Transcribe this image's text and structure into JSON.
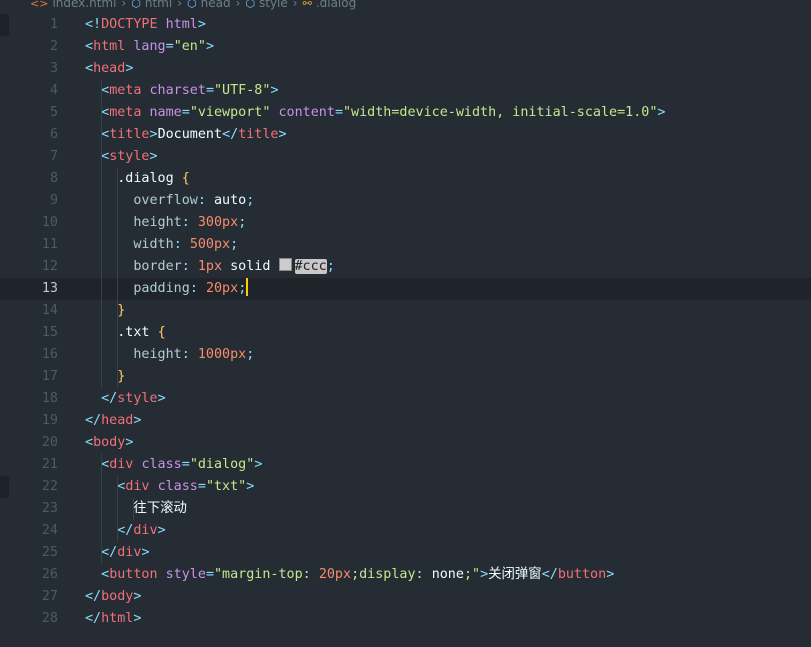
{
  "breadcrumb": [
    {
      "icon": "html-file-icon",
      "label": "index.html",
      "color": "#e37933"
    },
    {
      "icon": "cube-icon",
      "label": "html",
      "color": "#75beff"
    },
    {
      "icon": "cube-icon",
      "label": "head",
      "color": "#75beff"
    },
    {
      "icon": "cube-icon",
      "label": "style",
      "color": "#75beff"
    },
    {
      "icon": "css-selector-icon",
      "label": ".dialog",
      "color": "#e8a33d"
    }
  ],
  "editor": {
    "active_line": 13,
    "cursor_line": 13,
    "lines": [
      [
        [
          "p",
          "<!"
        ],
        [
          "t",
          "DOCTYPE"
        ],
        [
          "x",
          " "
        ],
        [
          "a",
          "html"
        ],
        [
          "p",
          ">"
        ]
      ],
      [
        [
          "p",
          "<"
        ],
        [
          "t",
          "html"
        ],
        [
          "x",
          " "
        ],
        [
          "a",
          "lang"
        ],
        [
          "p",
          "="
        ],
        [
          "s",
          "\"en\""
        ],
        [
          "p",
          ">"
        ]
      ],
      [
        [
          "p",
          "<"
        ],
        [
          "t",
          "head"
        ],
        [
          "p",
          ">"
        ]
      ],
      [
        [
          "x",
          "  "
        ],
        [
          "p",
          "<"
        ],
        [
          "t",
          "meta"
        ],
        [
          "x",
          " "
        ],
        [
          "a",
          "charset"
        ],
        [
          "p",
          "="
        ],
        [
          "s",
          "\"UTF-8\""
        ],
        [
          "p",
          ">"
        ]
      ],
      [
        [
          "x",
          "  "
        ],
        [
          "p",
          "<"
        ],
        [
          "t",
          "meta"
        ],
        [
          "x",
          " "
        ],
        [
          "a",
          "name"
        ],
        [
          "p",
          "="
        ],
        [
          "s",
          "\"viewport\""
        ],
        [
          "x",
          " "
        ],
        [
          "a",
          "content"
        ],
        [
          "p",
          "="
        ],
        [
          "s",
          "\"width=device-width, initial-scale=1.0\""
        ],
        [
          "p",
          ">"
        ]
      ],
      [
        [
          "x",
          "  "
        ],
        [
          "p",
          "<"
        ],
        [
          "t",
          "title"
        ],
        [
          "p",
          ">"
        ],
        [
          "x",
          "Document"
        ],
        [
          "p",
          "</"
        ],
        [
          "t",
          "title"
        ],
        [
          "p",
          ">"
        ]
      ],
      [
        [
          "x",
          "  "
        ],
        [
          "p",
          "<"
        ],
        [
          "t",
          "style"
        ],
        [
          "p",
          ">"
        ]
      ],
      [
        [
          "x",
          "    "
        ],
        [
          "sel",
          ".dialog"
        ],
        [
          "x",
          " "
        ],
        [
          "b",
          "{"
        ]
      ],
      [
        [
          "x",
          "      "
        ],
        [
          "pr",
          "overflow"
        ],
        [
          "p",
          ":"
        ],
        [
          "x",
          " "
        ],
        [
          "k",
          "auto"
        ],
        [
          "p",
          ";"
        ]
      ],
      [
        [
          "x",
          "      "
        ],
        [
          "pr",
          "height"
        ],
        [
          "p",
          ":"
        ],
        [
          "x",
          " "
        ],
        [
          "n",
          "300px"
        ],
        [
          "p",
          ";"
        ]
      ],
      [
        [
          "x",
          "      "
        ],
        [
          "pr",
          "width"
        ],
        [
          "p",
          ":"
        ],
        [
          "x",
          " "
        ],
        [
          "n",
          "500px"
        ],
        [
          "p",
          ";"
        ]
      ],
      [
        [
          "x",
          "      "
        ],
        [
          "pr",
          "border"
        ],
        [
          "p",
          ":"
        ],
        [
          "x",
          " "
        ],
        [
          "n",
          "1px"
        ],
        [
          "x",
          " "
        ],
        [
          "k",
          "solid"
        ],
        [
          "x",
          " "
        ],
        [
          "sw",
          ""
        ],
        [
          "c",
          "#ccc"
        ],
        [
          "p",
          ";"
        ]
      ],
      [
        [
          "x",
          "      "
        ],
        [
          "pr",
          "padding"
        ],
        [
          "p",
          ":"
        ],
        [
          "x",
          " "
        ],
        [
          "n",
          "20px"
        ],
        [
          "p",
          ";"
        ],
        [
          "cur",
          ""
        ]
      ],
      [
        [
          "x",
          "    "
        ],
        [
          "b",
          "}"
        ]
      ],
      [
        [
          "x",
          "    "
        ],
        [
          "sel",
          ".txt"
        ],
        [
          "x",
          " "
        ],
        [
          "b",
          "{"
        ]
      ],
      [
        [
          "x",
          "      "
        ],
        [
          "pr",
          "height"
        ],
        [
          "p",
          ":"
        ],
        [
          "x",
          " "
        ],
        [
          "n",
          "1000px"
        ],
        [
          "p",
          ";"
        ]
      ],
      [
        [
          "x",
          "    "
        ],
        [
          "b",
          "}"
        ]
      ],
      [
        [
          "x",
          "  "
        ],
        [
          "p",
          "</"
        ],
        [
          "t",
          "style"
        ],
        [
          "p",
          ">"
        ]
      ],
      [
        [
          "p",
          "</"
        ],
        [
          "t",
          "head"
        ],
        [
          "p",
          ">"
        ]
      ],
      [
        [
          "p",
          "<"
        ],
        [
          "t",
          "body"
        ],
        [
          "p",
          ">"
        ]
      ],
      [
        [
          "x",
          "  "
        ],
        [
          "p",
          "<"
        ],
        [
          "t",
          "div"
        ],
        [
          "x",
          " "
        ],
        [
          "a",
          "class"
        ],
        [
          "p",
          "="
        ],
        [
          "s",
          "\"dialog\""
        ],
        [
          "p",
          ">"
        ]
      ],
      [
        [
          "x",
          "    "
        ],
        [
          "p",
          "<"
        ],
        [
          "t",
          "div"
        ],
        [
          "x",
          " "
        ],
        [
          "a",
          "class"
        ],
        [
          "p",
          "="
        ],
        [
          "s",
          "\"txt\""
        ],
        [
          "p",
          ">"
        ]
      ],
      [
        [
          "x",
          "      "
        ],
        [
          "x",
          "往下滚动"
        ]
      ],
      [
        [
          "x",
          "    "
        ],
        [
          "p",
          "</"
        ],
        [
          "t",
          "div"
        ],
        [
          "p",
          ">"
        ]
      ],
      [
        [
          "x",
          "  "
        ],
        [
          "p",
          "</"
        ],
        [
          "t",
          "div"
        ],
        [
          "p",
          ">"
        ]
      ],
      [
        [
          "x",
          "  "
        ],
        [
          "p",
          "<"
        ],
        [
          "t",
          "button"
        ],
        [
          "x",
          " "
        ],
        [
          "a",
          "style"
        ],
        [
          "p",
          "="
        ],
        [
          "s",
          "\"margin-top: "
        ],
        [
          "n",
          "20px"
        ],
        [
          "s",
          ";display: "
        ],
        [
          "k",
          "none"
        ],
        [
          "s",
          ";\""
        ],
        [
          "p",
          ">"
        ],
        [
          "x",
          "关闭弹窗"
        ],
        [
          "p",
          "</"
        ],
        [
          "t",
          "button"
        ],
        [
          "p",
          ">"
        ]
      ],
      [
        [
          "p",
          "</"
        ],
        [
          "t",
          "body"
        ],
        [
          "p",
          ">"
        ]
      ],
      [
        [
          "p",
          "</"
        ],
        [
          "t",
          "html"
        ],
        [
          "p",
          ">"
        ]
      ]
    ]
  }
}
